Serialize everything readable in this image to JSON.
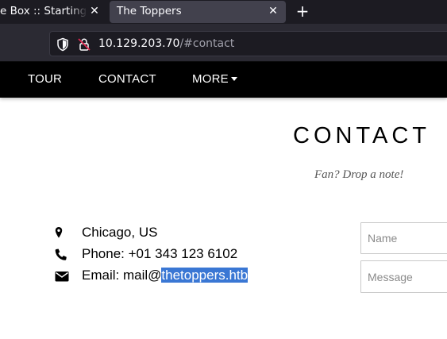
{
  "browser": {
    "tabs": [
      {
        "label": "e Box :: Starting P",
        "active": false
      },
      {
        "label": "The Toppers",
        "active": true
      }
    ],
    "tab_close_glyph": "✕",
    "new_tab_glyph": "+",
    "url_host": "10.129.203.70",
    "url_path": "/#contact",
    "icons": [
      "shield-icon",
      "insecure-lock-icon"
    ]
  },
  "site": {
    "nav": {
      "items": [
        {
          "label": "TOUR"
        },
        {
          "label": "CONTACT"
        },
        {
          "label": "MORE"
        }
      ]
    },
    "contact": {
      "title": "CONTACT",
      "subtitle": "Fan? Drop a note!",
      "info": [
        {
          "icon": "map-marker-icon",
          "text": "Chicago, US"
        },
        {
          "icon": "phone-icon",
          "text": "Phone: +01 343 123 6102"
        },
        {
          "icon": "envelope-icon",
          "label": "Email: mail@",
          "highlighted": "thetoppers.htb"
        }
      ],
      "form": {
        "name_placeholder": "Name",
        "message_placeholder": "Message"
      }
    },
    "colors": {
      "nav_background": "#000000",
      "selection_highlight": "#3a77d4",
      "tab_strip": "#1c1b22",
      "toolbar": "#2b2a33"
    }
  }
}
